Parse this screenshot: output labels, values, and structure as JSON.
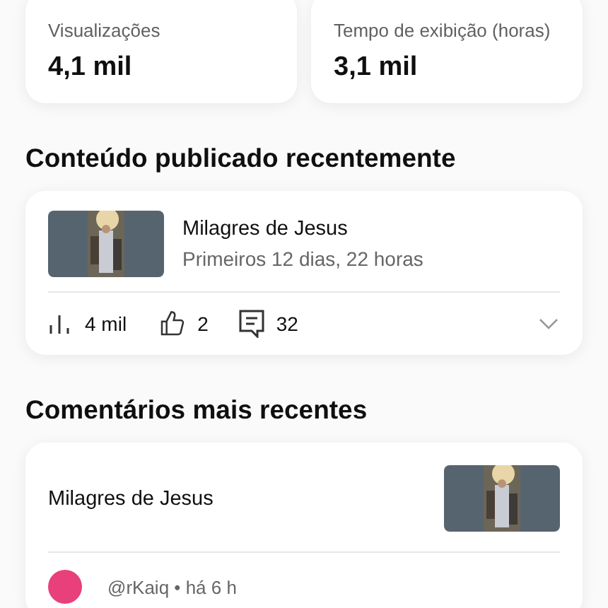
{
  "stats": [
    {
      "label": "Visualizações",
      "value": "4,1 mil"
    },
    {
      "label": "Tempo de exibição (horas)",
      "value": "3,1 mil"
    }
  ],
  "recent_content": {
    "heading": "Conteúdo publicado recentemente",
    "item": {
      "title": "Milagres de Jesus",
      "subtitle": "Primeiros 12 dias, 22 horas"
    },
    "metrics": [
      {
        "kind": "views",
        "value": "4 mil"
      },
      {
        "kind": "likes",
        "value": "2"
      },
      {
        "kind": "comments",
        "value": "32"
      }
    ],
    "expanded": false
  },
  "recent_comments": {
    "heading": "Comentários mais recentes",
    "video_title": "Milagres de Jesus",
    "comment": {
      "author": "@rKaiq • há 6 h"
    }
  }
}
